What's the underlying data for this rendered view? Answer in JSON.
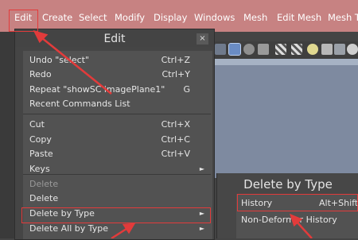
{
  "menubar": {
    "items": [
      "Edit",
      "Create",
      "Select",
      "Modify",
      "Display",
      "Windows",
      "Mesh",
      "Edit Mesh",
      "Mesh To"
    ]
  },
  "edit_menu": {
    "title": "Edit",
    "close_glyph": "×",
    "rows": [
      {
        "label": "Undo \"select\"",
        "shortcut": "Ctrl+Z"
      },
      {
        "label": "Redo",
        "shortcut": "Ctrl+Y"
      },
      {
        "label": "Repeat \"showSC imagePlane1\"",
        "shortcut": "G"
      },
      {
        "label": "Recent Commands List",
        "shortcut": ""
      },
      {
        "label": "Cut",
        "shortcut": "Ctrl+X"
      },
      {
        "label": "Copy",
        "shortcut": "Ctrl+C"
      },
      {
        "label": "Paste",
        "shortcut": "Ctrl+V"
      },
      {
        "label": "Keys",
        "shortcut": "",
        "submenu": true
      },
      {
        "label": "Delete",
        "section": true
      },
      {
        "label": "Delete",
        "shortcut": ""
      },
      {
        "label": "Delete by Type",
        "shortcut": "",
        "submenu": true
      },
      {
        "label": "Delete All by Type",
        "shortcut": "",
        "submenu": true
      }
    ],
    "arrow_glyph": "►"
  },
  "submenu": {
    "title": "Delete by Type",
    "rows": [
      {
        "label": "History",
        "shortcut": "Alt+Shift+"
      },
      {
        "label": "Non-Deformer History",
        "shortcut": ""
      }
    ]
  },
  "colors": {
    "menubar": "#c78282",
    "highlight": "#e23b3b",
    "viewport": "#7e8aa0"
  },
  "toolbar_icons": [
    "vertex-icon",
    "cube-icon",
    "shaded-icon",
    "speaker-icon",
    "checker-icon",
    "checker-icon",
    "light-icon",
    "grid-icon",
    "screen-icon",
    "sphere-icon",
    "dots-icon"
  ]
}
